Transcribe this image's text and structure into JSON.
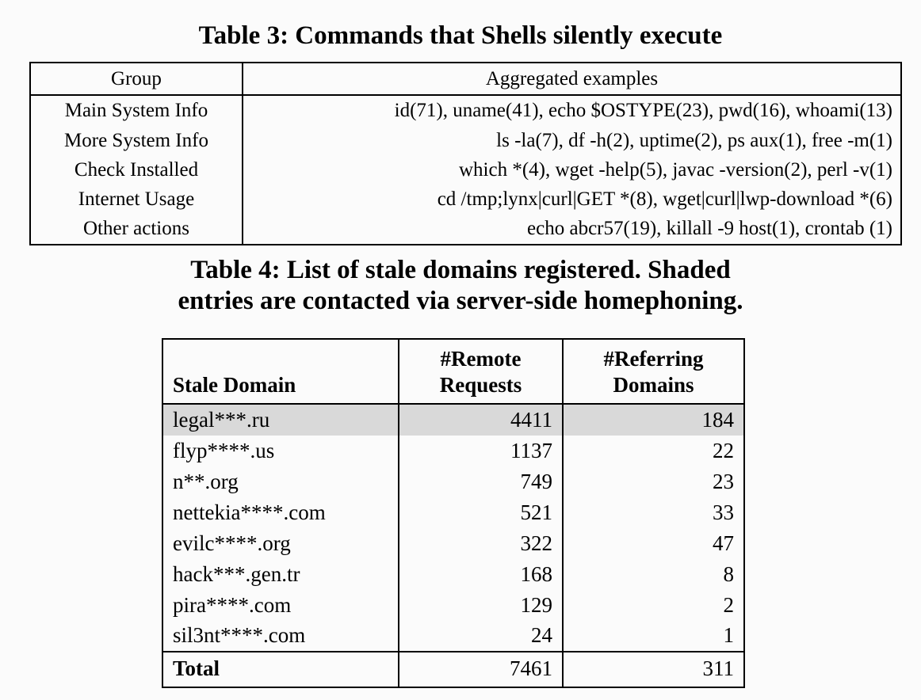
{
  "table3": {
    "caption": "Table 3: Commands that Shells silently execute",
    "headers": [
      "Group",
      "Aggregated examples"
    ],
    "rows": [
      {
        "group": "Main System Info",
        "examples": "id(71), uname(41), echo $OSTYPE(23), pwd(16), whoami(13)"
      },
      {
        "group": "More System Info",
        "examples": "ls -la(7), df -h(2), uptime(2), ps aux(1), free -m(1)"
      },
      {
        "group": "Check Installed",
        "examples": "which *(4), wget -help(5), javac -version(2), perl -v(1)"
      },
      {
        "group": "Internet Usage",
        "examples": "cd /tmp;lynx|curl|GET *(8), wget|curl|lwp-download *(6)"
      },
      {
        "group": "Other actions",
        "examples": "echo abcr57(19), killall -9 host(1), crontab (1)"
      }
    ]
  },
  "table4": {
    "caption_line1": "Table 4:  List of stale domains registered.   Shaded",
    "caption_line2": "entries are contacted via server-side homephoning.",
    "headers": [
      "Stale Domain",
      "#Remote Requests",
      "#Referring Domains"
    ],
    "header_parts": {
      "domain": "Stale Domain",
      "remote_line1": "#Remote",
      "remote_line2": "Requests",
      "referring_line1": "#Referring",
      "referring_line2": "Domains"
    },
    "shaded_color": "#d9d9d9",
    "rows": [
      {
        "domain": "legal***.ru",
        "remote_requests": "4411",
        "referring_domains": "184",
        "shaded": true
      },
      {
        "domain": "flyp****.us",
        "remote_requests": "1137",
        "referring_domains": "22",
        "shaded": false
      },
      {
        "domain": "n**.org",
        "remote_requests": "749",
        "referring_domains": "23",
        "shaded": false
      },
      {
        "domain": "nettekia****.com",
        "remote_requests": "521",
        "referring_domains": "33",
        "shaded": false
      },
      {
        "domain": "evilc****.org",
        "remote_requests": "322",
        "referring_domains": "47",
        "shaded": false
      },
      {
        "domain": "hack***.gen.tr",
        "remote_requests": "168",
        "referring_domains": "8",
        "shaded": false
      },
      {
        "domain": "pira****.com",
        "remote_requests": "129",
        "referring_domains": "2",
        "shaded": false
      },
      {
        "domain": "sil3nt****.com",
        "remote_requests": "24",
        "referring_domains": "1",
        "shaded": false
      }
    ],
    "total": {
      "label": "Total",
      "remote_requests": "7461",
      "referring_domains": "311"
    }
  }
}
